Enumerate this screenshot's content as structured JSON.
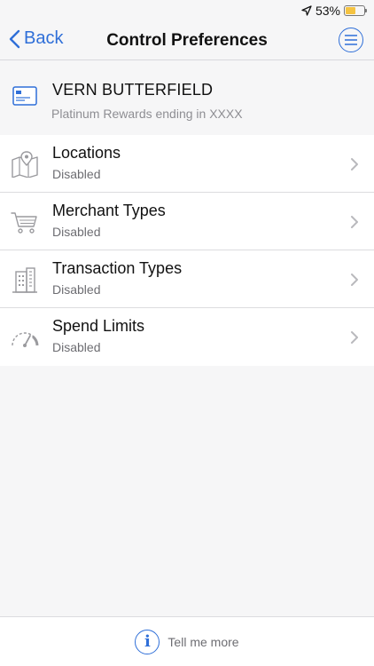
{
  "status": {
    "battery_text": "53%",
    "battery_level": 0.53
  },
  "nav": {
    "back_label": "Back",
    "title": "Control Preferences"
  },
  "card": {
    "name": "VERN BUTTERFIELD",
    "description": "Platinum Rewards ending in XXXX"
  },
  "items": [
    {
      "title": "Locations",
      "status": "Disabled",
      "icon": "map-pin-icon"
    },
    {
      "title": "Merchant Types",
      "status": "Disabled",
      "icon": "shopping-cart-icon"
    },
    {
      "title": "Transaction Types",
      "status": "Disabled",
      "icon": "buildings-icon"
    },
    {
      "title": "Spend Limits",
      "status": "Disabled",
      "icon": "speedometer-icon"
    }
  ],
  "footer": {
    "label": "Tell me more"
  },
  "colors": {
    "accent": "#2f6fd8",
    "battery": "#f5c342"
  }
}
